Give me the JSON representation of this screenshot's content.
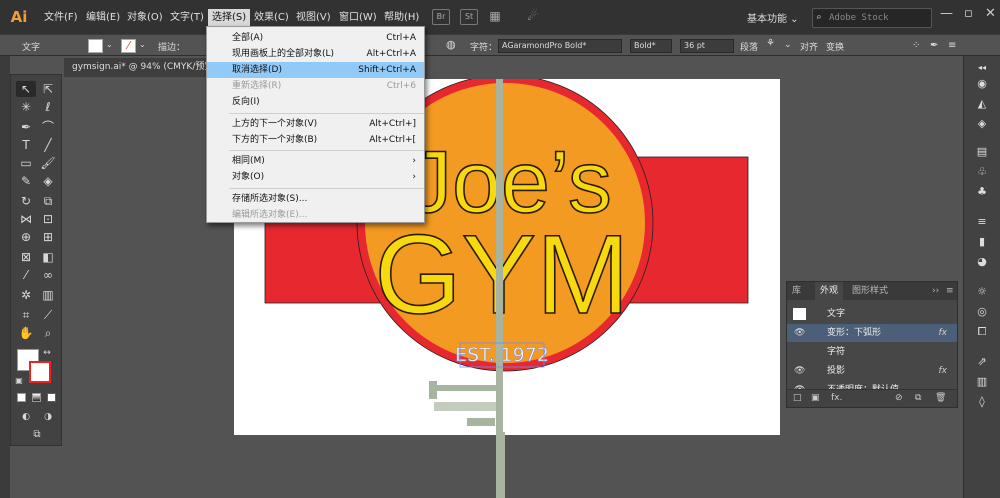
{
  "app": {
    "logo": "Ai"
  },
  "menubar": {
    "items": [
      "文件(F)",
      "编辑(E)",
      "对象(O)",
      "文字(T)",
      "选择(S)",
      "效果(C)",
      "视图(V)",
      "窗口(W)",
      "帮助(H)"
    ],
    "workspace": "基本功能 ⌄",
    "stock_search_placeholder": "Adobe Stock"
  },
  "control_bar": {
    "label": "文字",
    "stroke_label": "描边：",
    "char_label": "字符：",
    "font_family": "AGaramondPro Bold*",
    "font_style": "Bold*",
    "font_size": "36 pt",
    "paragraph_label": "段落",
    "align_label": "对齐",
    "transform_label": "变换"
  },
  "document_tab": {
    "title": "gymsign.ai* @ 94% (CMYK/预览"
  },
  "select_menu": {
    "items": [
      {
        "label": "全部(A)",
        "shortcut": "Ctrl+A",
        "state": "normal"
      },
      {
        "label": "现用画板上的全部对象(L)",
        "shortcut": "Alt+Ctrl+A",
        "state": "normal"
      },
      {
        "label": "取消选择(D)",
        "shortcut": "Shift+Ctrl+A",
        "state": "highlighted"
      },
      {
        "label": "重新选择(R)",
        "shortcut": "Ctrl+6",
        "state": "disabled"
      },
      {
        "label": "反向(I)",
        "shortcut": "",
        "state": "normal"
      },
      {
        "label": "上方的下一个对象(V)",
        "shortcut": "Alt+Ctrl+]",
        "state": "normal"
      },
      {
        "label": "下方的下一个对象(B)",
        "shortcut": "Alt+Ctrl+[",
        "state": "normal"
      },
      {
        "label": "相同(M)",
        "shortcut": "",
        "state": "submenu"
      },
      {
        "label": "对象(O)",
        "shortcut": "",
        "state": "submenu"
      },
      {
        "label": "存储所选对象(S)...",
        "shortcut": "",
        "state": "normal"
      },
      {
        "label": "编辑所选对象(E)...",
        "shortcut": "",
        "state": "disabled"
      }
    ]
  },
  "artwork": {
    "line1": "Joe’s",
    "line2": "GYM",
    "est": "EST. 1972",
    "colors": {
      "red": "#e8282f",
      "orange": "#f39a22",
      "yellow": "#f7d90f",
      "sage": "#a9b4a0"
    }
  },
  "appearance_panel": {
    "tabs": [
      "库",
      "外观",
      "图形样式"
    ],
    "rows": [
      {
        "label": "文字",
        "fx": "",
        "eye": false
      },
      {
        "label": "变形：下弧形",
        "fx": "fx",
        "eye": true
      },
      {
        "label": "字符",
        "fx": "",
        "eye": false
      },
      {
        "label": "投影",
        "fx": "fx",
        "eye": true
      },
      {
        "label": "不透明度：默认值",
        "fx": "",
        "eye": true
      }
    ]
  }
}
